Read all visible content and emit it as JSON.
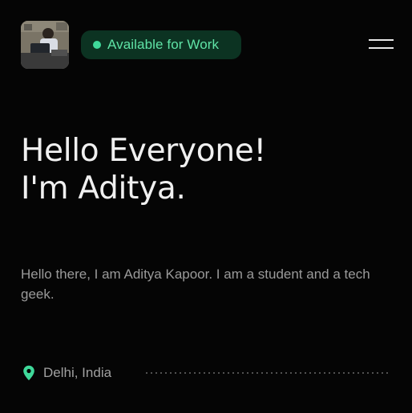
{
  "header": {
    "avatar_icon": "profile-photo",
    "status_badge": {
      "label": "Available for Work",
      "dot_color": "#3fd99a",
      "background": "#0c3322",
      "text_color": "#5fe3a6"
    },
    "menu_icon": "hamburger-menu-icon"
  },
  "hero": {
    "headline_line1": "Hello Everyone!",
    "headline_line2": "I'm Aditya.",
    "intro": "Hello there, I am Aditya Kapoor. I am a student and a tech geek."
  },
  "footer": {
    "location_icon": "map-pin-icon",
    "location_color": "#3fd99a",
    "location": "Delhi, India"
  },
  "colors": {
    "background": "#050505",
    "accent": "#3fd99a"
  }
}
